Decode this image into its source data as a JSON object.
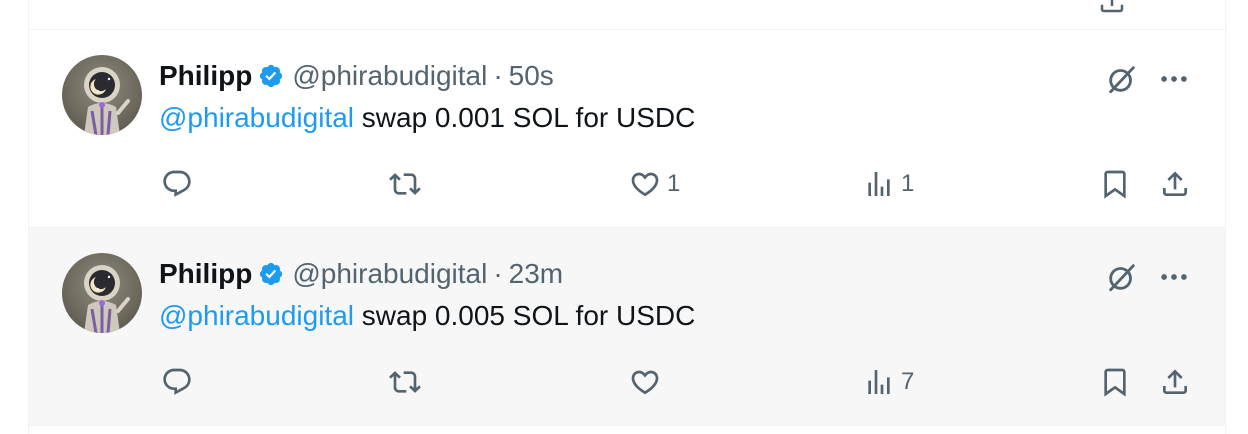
{
  "colors": {
    "accent": "#1d9bf0",
    "text_primary": "#0f1419",
    "text_secondary": "#536471",
    "hover_background": "#f7f7f7"
  },
  "icons": {
    "verified": "verified-badge-icon",
    "grok": "grok-icon",
    "more": "more-icon",
    "reply": "reply-icon",
    "retweet": "retweet-icon",
    "like": "heart-icon",
    "views": "views-icon",
    "bookmark": "bookmark-icon",
    "share": "share-icon"
  },
  "tweets": [
    {
      "name": "Philipp",
      "handle": "@phirabudigital",
      "separator": "·",
      "time": "50s",
      "mention": "@phirabudigital",
      "body": " swap 0.001 SOL for USDC",
      "reply_count": "",
      "retweet_count": "",
      "like_count": "1",
      "view_count": "1"
    },
    {
      "name": "Philipp",
      "handle": "@phirabudigital",
      "separator": "·",
      "time": "23m",
      "mention": "@phirabudigital",
      "body": " swap 0.005 SOL for USDC",
      "reply_count": "",
      "retweet_count": "",
      "like_count": "",
      "view_count": "7"
    }
  ]
}
